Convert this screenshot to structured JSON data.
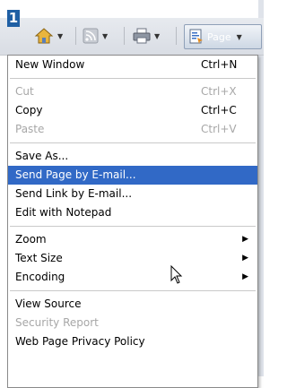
{
  "badge": "1",
  "toolbar": {
    "page_label": "Page",
    "icons": [
      "home-icon",
      "feed-icon",
      "print-icon",
      "page-icon"
    ]
  },
  "menu": {
    "items": [
      {
        "label": "New Window",
        "shortcut": "Ctrl+N"
      },
      {
        "label": "Cut",
        "shortcut": "Ctrl+X",
        "disabled": true
      },
      {
        "label": "Copy",
        "shortcut": "Ctrl+C"
      },
      {
        "label": "Paste",
        "shortcut": "Ctrl+V",
        "disabled": true
      },
      {
        "label": "Save As..."
      },
      {
        "label": "Send Page by E-mail...",
        "highlighted": true
      },
      {
        "label": "Send Link by E-mail..."
      },
      {
        "label": "Edit with Notepad"
      },
      {
        "label": "Zoom",
        "submenu": true
      },
      {
        "label": "Text Size",
        "submenu": true
      },
      {
        "label": "Encoding",
        "submenu": true
      },
      {
        "label": "View Source"
      },
      {
        "label": "Security Report",
        "disabled": true
      },
      {
        "label": "Web Page Privacy Policy"
      }
    ]
  },
  "colors": {
    "highlight": "#3169c6",
    "badge": "#1f5fa4"
  }
}
